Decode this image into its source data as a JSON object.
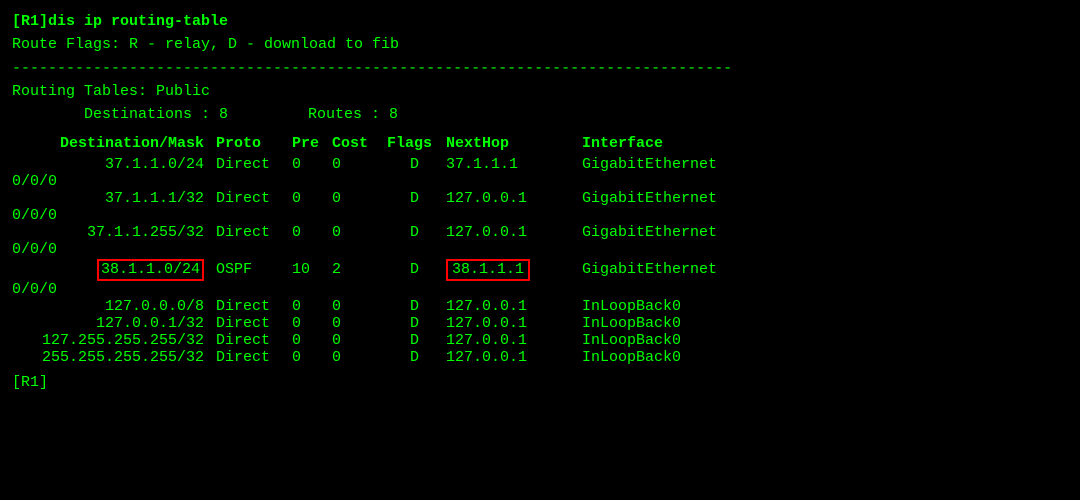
{
  "terminal": {
    "prompt_cmd": "[R1]dis ip routing-table",
    "route_flags": "Route Flags: R - relay, D - download to fib",
    "separator": "--------------------------------------------------------------------------------",
    "routing_tables_label": "Routing Tables: Public",
    "destinations_label": "        Destinations : 8",
    "routes_label": "Routes : 8",
    "table_header": {
      "dest_mask": "Destination/Mask",
      "proto": "Proto",
      "pre": "Pre",
      "cost": "Cost",
      "flags": "Flags",
      "nexthop": "NextHop",
      "interface": "Interface"
    },
    "rows": [
      {
        "dest": "37.1.1.0/24",
        "proto": "Direct",
        "pre": "0",
        "cost": "0",
        "flags": "D",
        "nexthop": "37.1.1.1",
        "interface": "GigabitEthernet",
        "interface2": "0/0/0",
        "highlight": false
      },
      {
        "dest": "37.1.1.1/32",
        "proto": "Direct",
        "pre": "0",
        "cost": "0",
        "flags": "D",
        "nexthop": "127.0.0.1",
        "interface": "GigabitEthernet",
        "interface2": "0/0/0",
        "highlight": false
      },
      {
        "dest": "37.1.1.255/32",
        "proto": "Direct",
        "pre": "0",
        "cost": "0",
        "flags": "D",
        "nexthop": "127.0.0.1",
        "interface": "GigabitEthernet",
        "interface2": "0/0/0",
        "highlight": false
      },
      {
        "dest": "38.1.1.0/24",
        "proto": "OSPF",
        "pre": "10",
        "cost": "2",
        "flags": "D",
        "nexthop": "38.1.1.1",
        "interface": "GigabitEthernet",
        "interface2": "0/0/0",
        "highlight": true
      },
      {
        "dest": "127.0.0.0/8",
        "proto": "Direct",
        "pre": "0",
        "cost": "0",
        "flags": "D",
        "nexthop": "127.0.0.1",
        "interface": "InLoopBack0",
        "interface2": "",
        "highlight": false
      },
      {
        "dest": "127.0.0.1/32",
        "proto": "Direct",
        "pre": "0",
        "cost": "0",
        "flags": "D",
        "nexthop": "127.0.0.1",
        "interface": "InLoopBack0",
        "interface2": "",
        "highlight": false
      },
      {
        "dest": "127.255.255.255/32",
        "proto": "Direct",
        "pre": "0",
        "cost": "0",
        "flags": "D",
        "nexthop": "127.0.0.1",
        "interface": "InLoopBack0",
        "interface2": "",
        "highlight": false
      },
      {
        "dest": "255.255.255.255/32",
        "proto": "Direct",
        "pre": "0",
        "cost": "0",
        "flags": "D",
        "nexthop": "127.0.0.1",
        "interface": "InLoopBack0",
        "interface2": "",
        "highlight": false
      }
    ],
    "end_prompt": "[R1]"
  }
}
